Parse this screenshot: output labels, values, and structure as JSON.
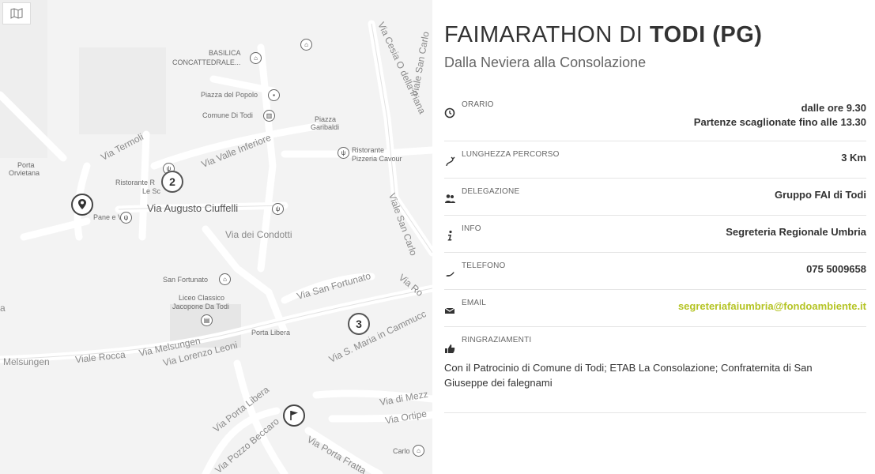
{
  "map": {
    "toggle_icon": "map-icon",
    "labels": {
      "basilica": "BASILICA",
      "concattedrale": "CONCATTEDRALE...",
      "piazza_popolo": "Piazza del Popolo",
      "comune_todi": "Comune Di Todi",
      "piazza": "Piazza",
      "garibaldi": "Garibaldi",
      "ristorante_pizzeria_1": "Ristorante",
      "ristorante_pizzeria_2": "Pizzeria Cavour",
      "porta": "Porta",
      "orvietana": "Orvietana",
      "via_termoli": "Via Termoli",
      "via_valle_inferiore": "Via Valle Inferiore",
      "ristorante_r": "Ristorante R",
      "le_sc": "Le Sc",
      "ciuffelli": "Via Augusto Ciuffelli",
      "pane_vino": "Pane e Vino",
      "condotti": "Via dei Condotti",
      "san_fortunato": "San Fortunato",
      "liceo_1": "Liceo Classico",
      "liceo_2": "Jacopone Da Todi",
      "via_san_fortunato": "Via San Fortunato",
      "porta_libera": "Porta Libera",
      "viale_rocca": "Viale Rocca",
      "melsungen_1": "Melsungen",
      "melsungen_2": "Via Melsungen",
      "lorenzo_leoni": "Via Lorenzo Leoni",
      "via_s_maria": "Via S. Maria in Cammucc",
      "via_porta_libera": "Via Porta Libera",
      "via_pozzo_beccaro": "Via Pozzo Beccaro",
      "via_porta_fratta": "Via Porta Fratta",
      "via_di_mezzo": "Via di Mezz",
      "via_ortipe": "Via Ortipe",
      "carlo": "Carlo",
      "via_cesia": "Via Cesia O della Piana",
      "viale_san_carlo_1": "Viale San Carlo",
      "viale_san_carlo_2": "Viale San Carlo",
      "via_ro": "Via Ro",
      "a": "a"
    },
    "markers": {
      "two": "2",
      "three": "3"
    }
  },
  "event": {
    "title_prefix": "FAIMARATHON DI ",
    "title_bold": "TODI (PG)",
    "subtitle": "Dalla Neviera alla Consolazione"
  },
  "details": [
    {
      "icon": "clock-icon",
      "label": "ORARIO",
      "value_line1": "dalle ore 9.30",
      "value_line2": "Partenze scaglionate fino alle 13.30"
    },
    {
      "icon": "route-icon",
      "label": "LUNGHEZZA PERCORSO",
      "value": "3 Km"
    },
    {
      "icon": "people-icon",
      "label": "DELEGAZIONE",
      "value": "Gruppo FAI di Todi"
    },
    {
      "icon": "info-icon",
      "label": "INFO",
      "value": "Segreteria Regionale Umbria"
    },
    {
      "icon": "phone-icon",
      "label": "TELEFONO",
      "value": "075 5009658"
    },
    {
      "icon": "email-icon",
      "label": "EMAIL",
      "value": "segreteriafaiumbria@fondoambiente.it"
    },
    {
      "icon": "thumbs-up-icon",
      "label": "RINGRAZIAMENTI",
      "value": "Con il Patrocinio di Comune di Todi; ETAB La Consolazione; Confraternita di San Giuseppe dei falegnami"
    }
  ],
  "colors": {
    "accent_green": "#b5c425"
  }
}
